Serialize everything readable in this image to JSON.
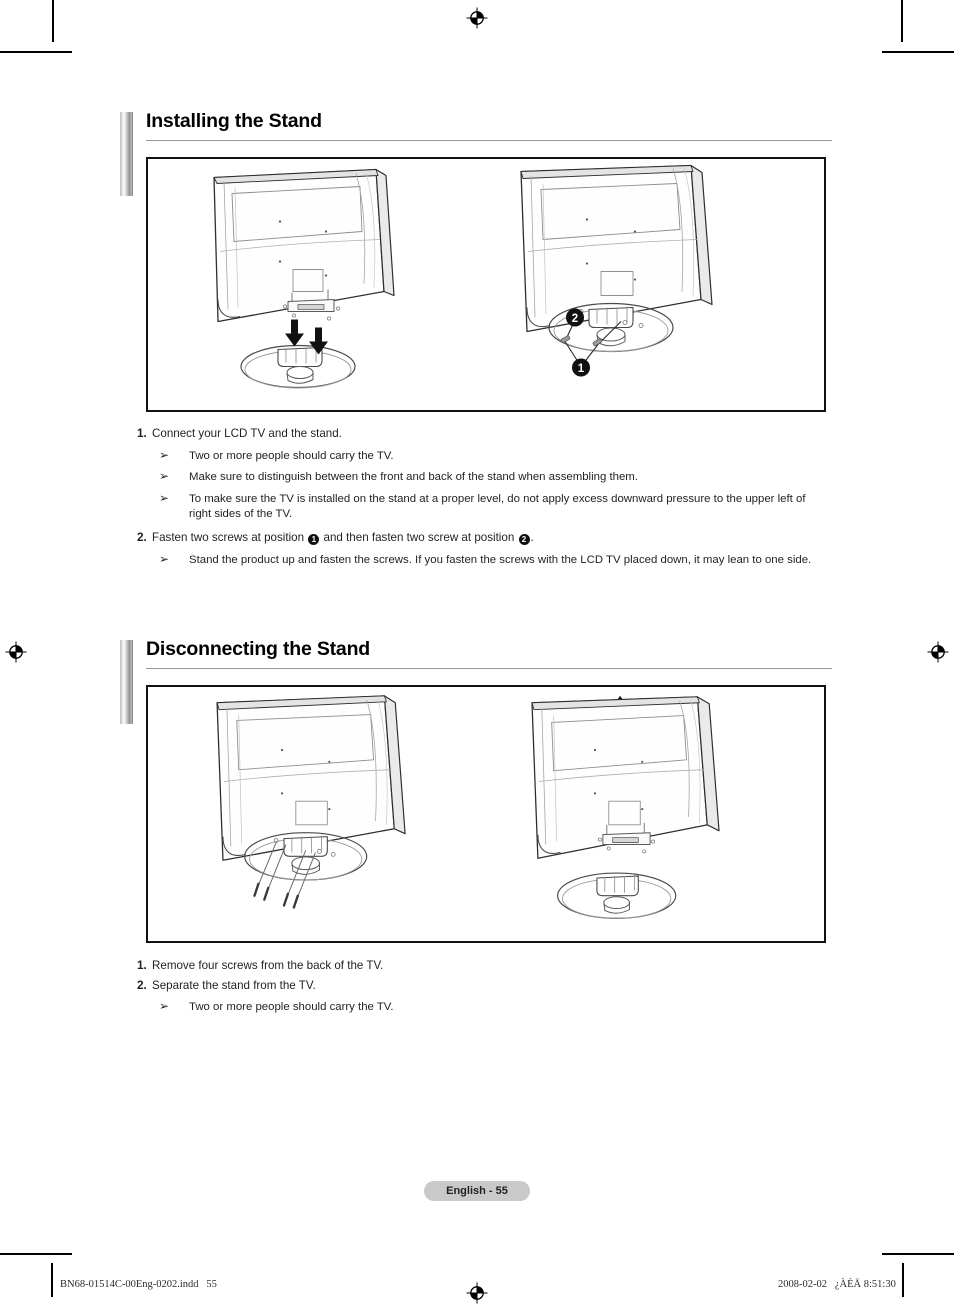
{
  "document": {
    "page_label": "English - 55",
    "slug_left": "BN68-01514C-00Eng-0202.indd   55",
    "slug_right": "2008-02-02   ¿ÀÈÄ 8:51:30"
  },
  "sections": [
    {
      "id": "install",
      "title": "Installing the Stand",
      "figure": {
        "left_caption": "",
        "right_caption": "",
        "callouts": [
          "1",
          "2"
        ]
      },
      "steps": [
        {
          "num": "1.",
          "text": "Connect your LCD TV and the stand.",
          "subs": [
            "Two or more people should carry the TV.",
            "Make sure to distinguish between the front and back of the stand when assembling them.",
            "To make sure the TV is installed on the stand at a proper level, do not apply excess downward pressure to the upper left of right sides of the TV."
          ]
        },
        {
          "num": "2.",
          "text_before": "Fasten two screws at position ",
          "badge_1": "1",
          "text_middle": " and then fasten two screw at position ",
          "badge_2": "2",
          "text_after": ".",
          "subs": [
            "Stand the product up and fasten the screws. If you fasten the screws with the LCD TV placed down, it may lean to one side."
          ]
        }
      ]
    },
    {
      "id": "disconnect",
      "title": "Disconnecting the Stand",
      "steps": [
        {
          "num": "1.",
          "text": "Remove four screws from the back of the TV.",
          "subs": []
        },
        {
          "num": "2.",
          "text": "Separate the stand from the TV.",
          "subs": [
            "Two or more people should carry the TV."
          ]
        }
      ]
    }
  ],
  "icons": {
    "sub_bullet": "➢",
    "registration_mark": "registration-target",
    "crop_mark": "crop-mark"
  },
  "colors": {
    "heading_bar_gradient_light": "#ffffff",
    "heading_bar_gradient_dark": "#6e6e6e",
    "rule": "#9a9a9a",
    "figure_border": "#111111",
    "page_pill_bg": "#c9c9c9",
    "text": "#231f20"
  }
}
